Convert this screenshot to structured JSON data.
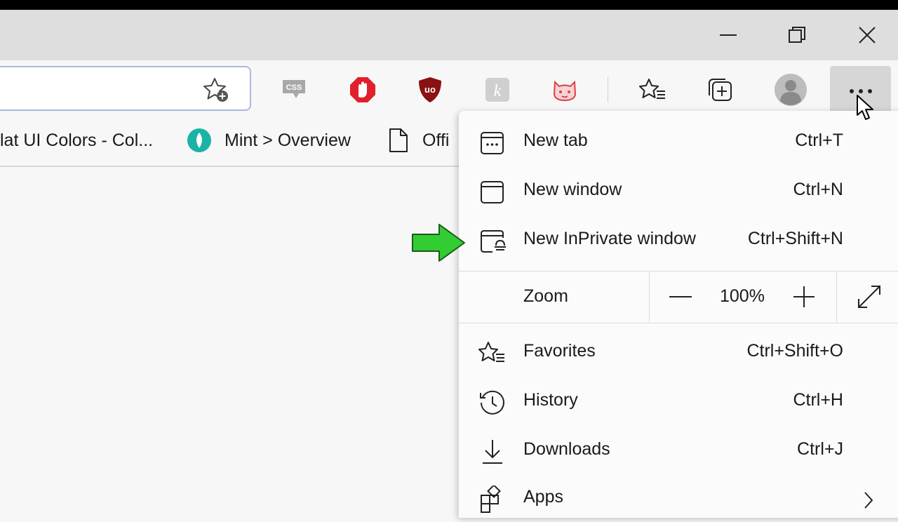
{
  "window": {
    "minimize_icon": "minimize-icon",
    "restore_icon": "restore-icon",
    "close_icon": "close-icon"
  },
  "toolbar": {
    "address_value": "",
    "extensions": [
      "css-extension-icon",
      "adblock-icon",
      "ublock-origin-icon",
      "k-extension-icon",
      "cat-extension-icon"
    ],
    "ublock_text": "uo",
    "css_text": "CSS",
    "k_text": "k"
  },
  "favorites_bar": {
    "items": [
      {
        "label": "lat UI Colors - Col...",
        "icon": "none"
      },
      {
        "label": "Mint > Overview",
        "icon": "mint-icon"
      },
      {
        "label": "Offi",
        "icon": "document-icon"
      }
    ]
  },
  "menu": {
    "items": [
      {
        "label": "New tab",
        "shortcut": "Ctrl+T",
        "icon": "new-tab-icon"
      },
      {
        "label": "New window",
        "shortcut": "Ctrl+N",
        "icon": "new-window-icon"
      },
      {
        "label": "New InPrivate window",
        "shortcut": "Ctrl+Shift+N",
        "icon": "inprivate-icon"
      }
    ],
    "zoom": {
      "label": "Zoom",
      "value": "100%",
      "minus": "zoom-out-icon",
      "plus": "zoom-in-icon",
      "fullscreen": "fullscreen-icon"
    },
    "items2": [
      {
        "label": "Favorites",
        "shortcut": "Ctrl+Shift+O",
        "icon": "favorites-icon"
      },
      {
        "label": "History",
        "shortcut": "Ctrl+H",
        "icon": "history-icon"
      },
      {
        "label": "Downloads",
        "shortcut": "Ctrl+J",
        "icon": "downloads-icon"
      },
      {
        "label": "Apps",
        "shortcut": "",
        "icon": "apps-icon"
      }
    ]
  },
  "colors": {
    "arrow": "#33cc33",
    "accent": "#aab8dc"
  }
}
